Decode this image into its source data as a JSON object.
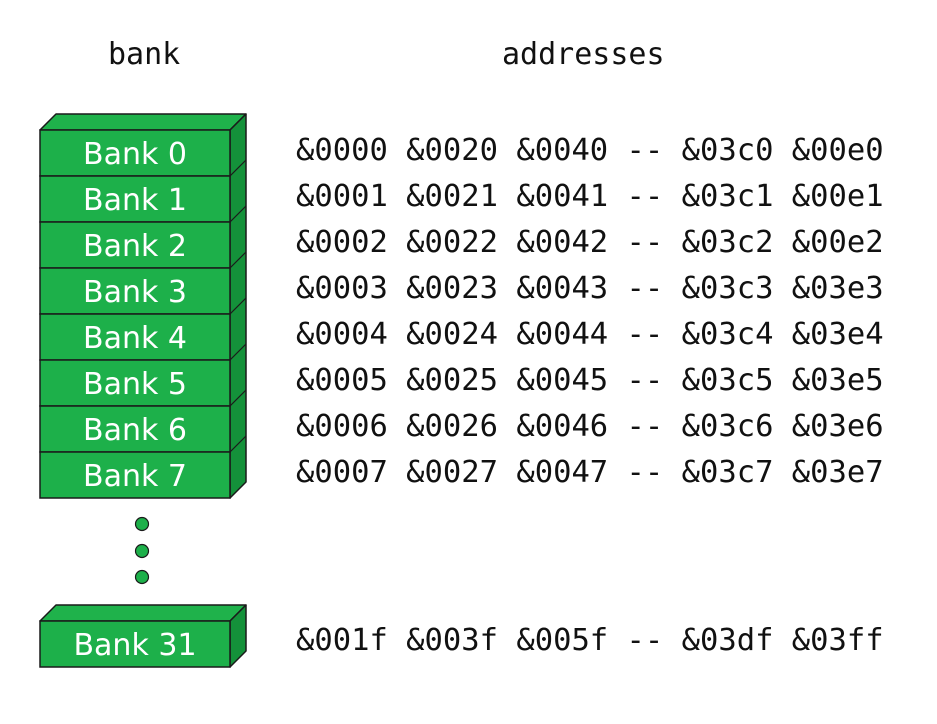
{
  "headers": {
    "bank": "bank",
    "addresses": "addresses"
  },
  "colors": {
    "bank_face": "#1db04a",
    "bank_top": "#1fb24b",
    "bank_side": "#14913a",
    "outline": "#1a1a1a",
    "dots": "#1db04a"
  },
  "banks": [
    {
      "label": "Bank 0",
      "addresses": "&0000 &0020 &0040 -- &03c0 &00e0"
    },
    {
      "label": "Bank 1",
      "addresses": "&0001 &0021 &0041 -- &03c1 &00e1"
    },
    {
      "label": "Bank 2",
      "addresses": "&0002 &0022 &0042 -- &03c2 &00e2"
    },
    {
      "label": "Bank 3",
      "addresses": "&0003 &0023 &0043 -- &03c3 &03e3"
    },
    {
      "label": "Bank 4",
      "addresses": "&0004 &0024 &0044 -- &03c4 &03e4"
    },
    {
      "label": "Bank 5",
      "addresses": "&0005 &0025 &0045 -- &03c5 &03e5"
    },
    {
      "label": "Bank 6",
      "addresses": "&0006 &0026 &0046 -- &03c6 &03e6"
    },
    {
      "label": "Bank 7",
      "addresses": "&0007 &0027 &0047 -- &03c7 &03e7"
    }
  ],
  "last_bank": {
    "label": "Bank 31",
    "addresses": "&001f &003f &005f -- &03df &03ff"
  }
}
